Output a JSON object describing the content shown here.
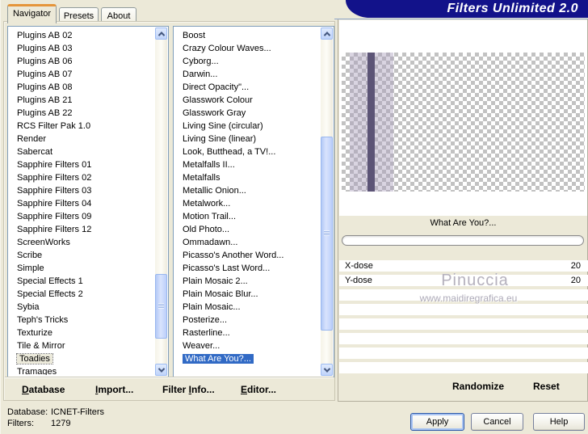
{
  "window": {
    "title": "Filters Unlimited 2.0"
  },
  "tabs": [
    {
      "label": "Navigator",
      "active": true
    },
    {
      "label": "Presets",
      "active": false
    },
    {
      "label": "About",
      "active": false
    }
  ],
  "category_list": {
    "selected": "Toadies",
    "items": [
      "Plugins AB 02",
      "Plugins AB 03",
      "Plugins AB 06",
      "Plugins AB 07",
      "Plugins AB 08",
      "Plugins AB 21",
      "Plugins AB 22",
      "RCS Filter Pak 1.0",
      "Render",
      "Sabercat",
      "Sapphire Filters 01",
      "Sapphire Filters 02",
      "Sapphire Filters 03",
      "Sapphire Filters 04",
      "Sapphire Filters 09",
      "Sapphire Filters 12",
      "ScreenWorks",
      "Scribe",
      "Simple",
      "Special Effects 1",
      "Special Effects 2",
      "Sybia",
      "Teph's Tricks",
      "Texturize",
      "Tile & Mirror",
      "Toadies",
      "Tramages"
    ]
  },
  "filter_list": {
    "selected": "What Are You?...",
    "items": [
      "Boost",
      "Crazy Colour Waves...",
      "Cyborg...",
      "Darwin...",
      "Direct Opacity\"...",
      "Glasswork Colour",
      "Glasswork Gray",
      "Living Sine (circular)",
      "Living Sine (linear)",
      "Look, Butthead, a TV!...",
      "Metalfalls II...",
      "Metalfalls",
      "Metallic Onion...",
      "Metalwork...",
      "Motion Trail...",
      "Old Photo...",
      "Ommadawn...",
      "Picasso's Another Word...",
      "Picasso's Last Word...",
      "Plain Mosaic 2...",
      "Plain Mosaic Blur...",
      "Plain Mosaic...",
      "Posterize...",
      "Rasterline...",
      "Weaver...",
      "What Are You?..."
    ]
  },
  "toolbar": {
    "database": {
      "accel": "D",
      "rest": "atabase"
    },
    "import_btn": {
      "accel": "I",
      "rest": "mport..."
    },
    "filter_info": {
      "pre": "Filter ",
      "accel": "I",
      "rest": "nfo..."
    },
    "editor": {
      "accel": "E",
      "rest": "ditor..."
    }
  },
  "preview": {
    "filter_name": "What Are You?...",
    "progress_percent": 0
  },
  "parameters": {
    "rows": [
      {
        "name": "X-dose",
        "value": "20"
      },
      {
        "name": "Y-dose",
        "value": "20"
      },
      {
        "name": "",
        "value": ""
      },
      {
        "name": "",
        "value": ""
      },
      {
        "name": "",
        "value": ""
      },
      {
        "name": "",
        "value": ""
      },
      {
        "name": "",
        "value": ""
      },
      {
        "name": "",
        "value": ""
      }
    ]
  },
  "watermark": {
    "line1": "Pinuccia",
    "line2": "www.maidiregrafica.eu"
  },
  "actions": {
    "randomize": "Randomize",
    "reset": "Reset",
    "apply": "Apply",
    "cancel": "Cancel",
    "help": "Help"
  },
  "status": {
    "database_label": "Database:",
    "database_value": "ICNET-Filters",
    "filters_label": "Filters:",
    "filters_value": "1279"
  },
  "colors": {
    "dialog_bg": "#ece9d8",
    "banner_navy": "#12128a",
    "selection_blue": "#316ac5",
    "tab_accent_orange": "#e5953a",
    "stripe_purple": "#5c5476",
    "watermark_gray": "#b5b1bd"
  }
}
